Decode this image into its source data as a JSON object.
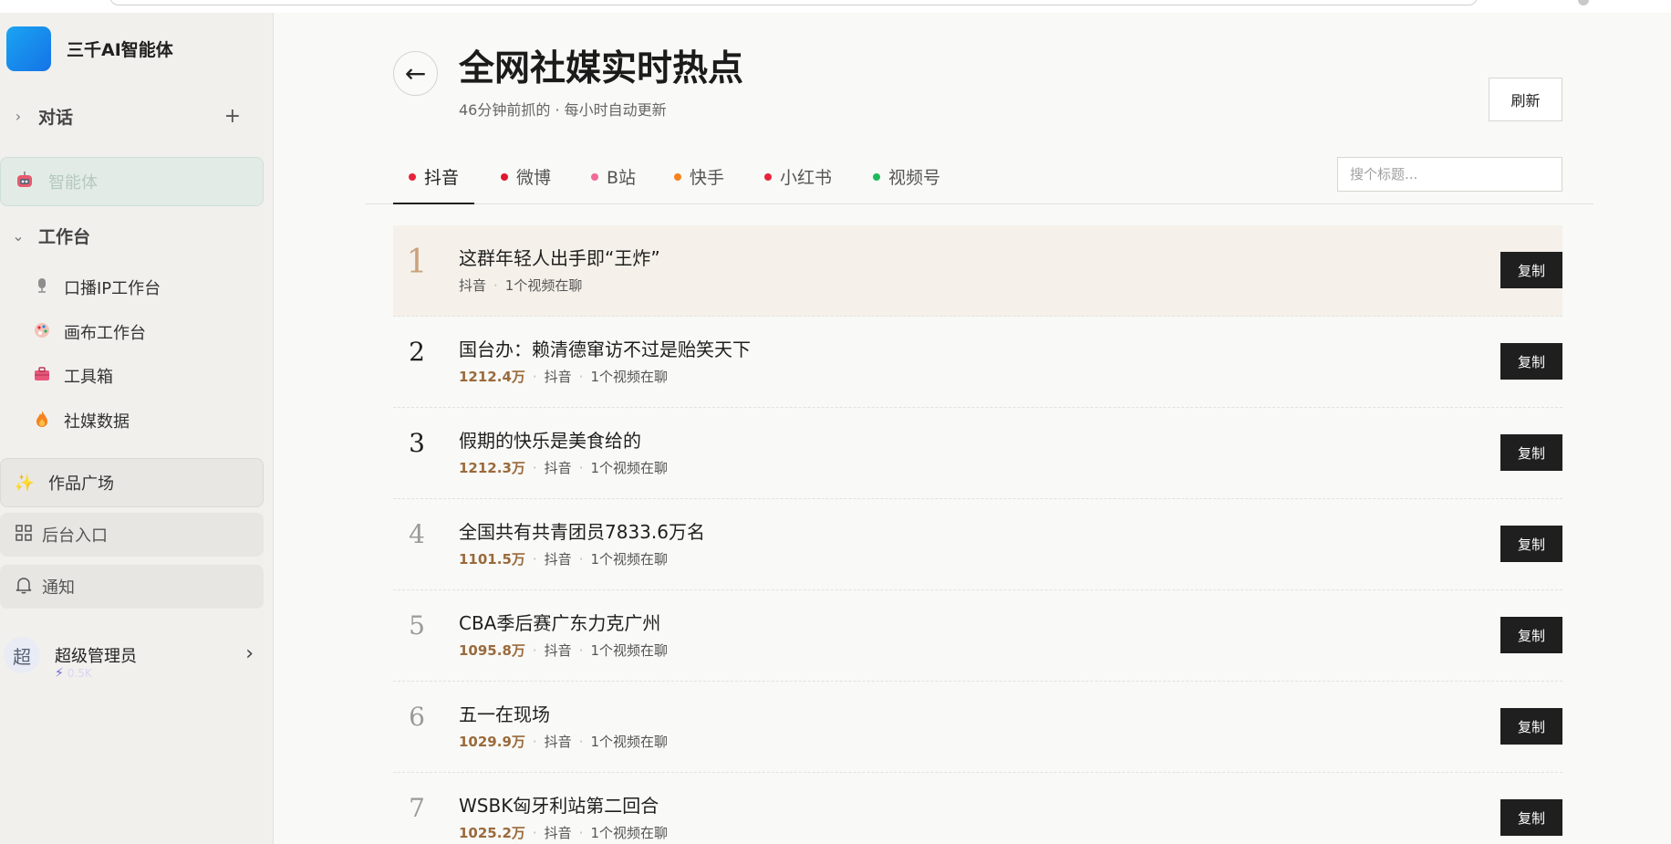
{
  "app": {
    "name": "三千AI智能体"
  },
  "sidebar": {
    "chat_label": "对话",
    "agent_label": "智能体",
    "workbench_label": "工作台",
    "workbench_items": [
      {
        "label": "口播IP工作台",
        "icon": "microphone-icon"
      },
      {
        "label": "画布工作台",
        "icon": "palette-icon"
      },
      {
        "label": "工具箱",
        "icon": "toolbox-icon"
      },
      {
        "label": "社媒数据",
        "icon": "fire-icon"
      }
    ],
    "works_label": "作品广场",
    "backend_label": "后台入口",
    "notify_label": "通知",
    "user": {
      "avatar_text": "超",
      "name": "超级管理员",
      "sub": "0.5K"
    }
  },
  "page": {
    "title": "全网社媒实时热点",
    "subtitle": "46分钟前抓的 · 每小时自动更新",
    "refresh_label": "刷新",
    "search_placeholder": "搜个标题..."
  },
  "tabs": [
    {
      "label": "抖音",
      "color": "#e5243b",
      "active": true
    },
    {
      "label": "微博",
      "color": "#e0182d",
      "active": false
    },
    {
      "label": "B站",
      "color": "#f06a9a",
      "active": false
    },
    {
      "label": "快手",
      "color": "#f5831f",
      "active": false
    },
    {
      "label": "小红书",
      "color": "#e5243b",
      "active": false
    },
    {
      "label": "视频号",
      "color": "#1fb85b",
      "active": false
    }
  ],
  "items": [
    {
      "rank": "1",
      "title": "这群年轻人出手即“王炸”",
      "heat": "",
      "platform": "抖音",
      "videos": "1个视频在聊",
      "copy": "复制"
    },
    {
      "rank": "2",
      "title": "国台办：赖清德窜访不过是贻笑天下",
      "heat": "1212.4万",
      "platform": "抖音",
      "videos": "1个视频在聊",
      "copy": "复制"
    },
    {
      "rank": "3",
      "title": "假期的快乐是美食给的",
      "heat": "1212.3万",
      "platform": "抖音",
      "videos": "1个视频在聊",
      "copy": "复制"
    },
    {
      "rank": "4",
      "title": "全国共有共青团员7833.6万名",
      "heat": "1101.5万",
      "platform": "抖音",
      "videos": "1个视频在聊",
      "copy": "复制"
    },
    {
      "rank": "5",
      "title": "CBA季后赛广东力克广州",
      "heat": "1095.8万",
      "platform": "抖音",
      "videos": "1个视频在聊",
      "copy": "复制"
    },
    {
      "rank": "6",
      "title": "五一在现场",
      "heat": "1029.9万",
      "platform": "抖音",
      "videos": "1个视频在聊",
      "copy": "复制"
    },
    {
      "rank": "7",
      "title": "WSBK匈牙利站第二回合",
      "heat": "1025.2万",
      "platform": "抖音",
      "videos": "1个视频在聊",
      "copy": "复制"
    }
  ]
}
